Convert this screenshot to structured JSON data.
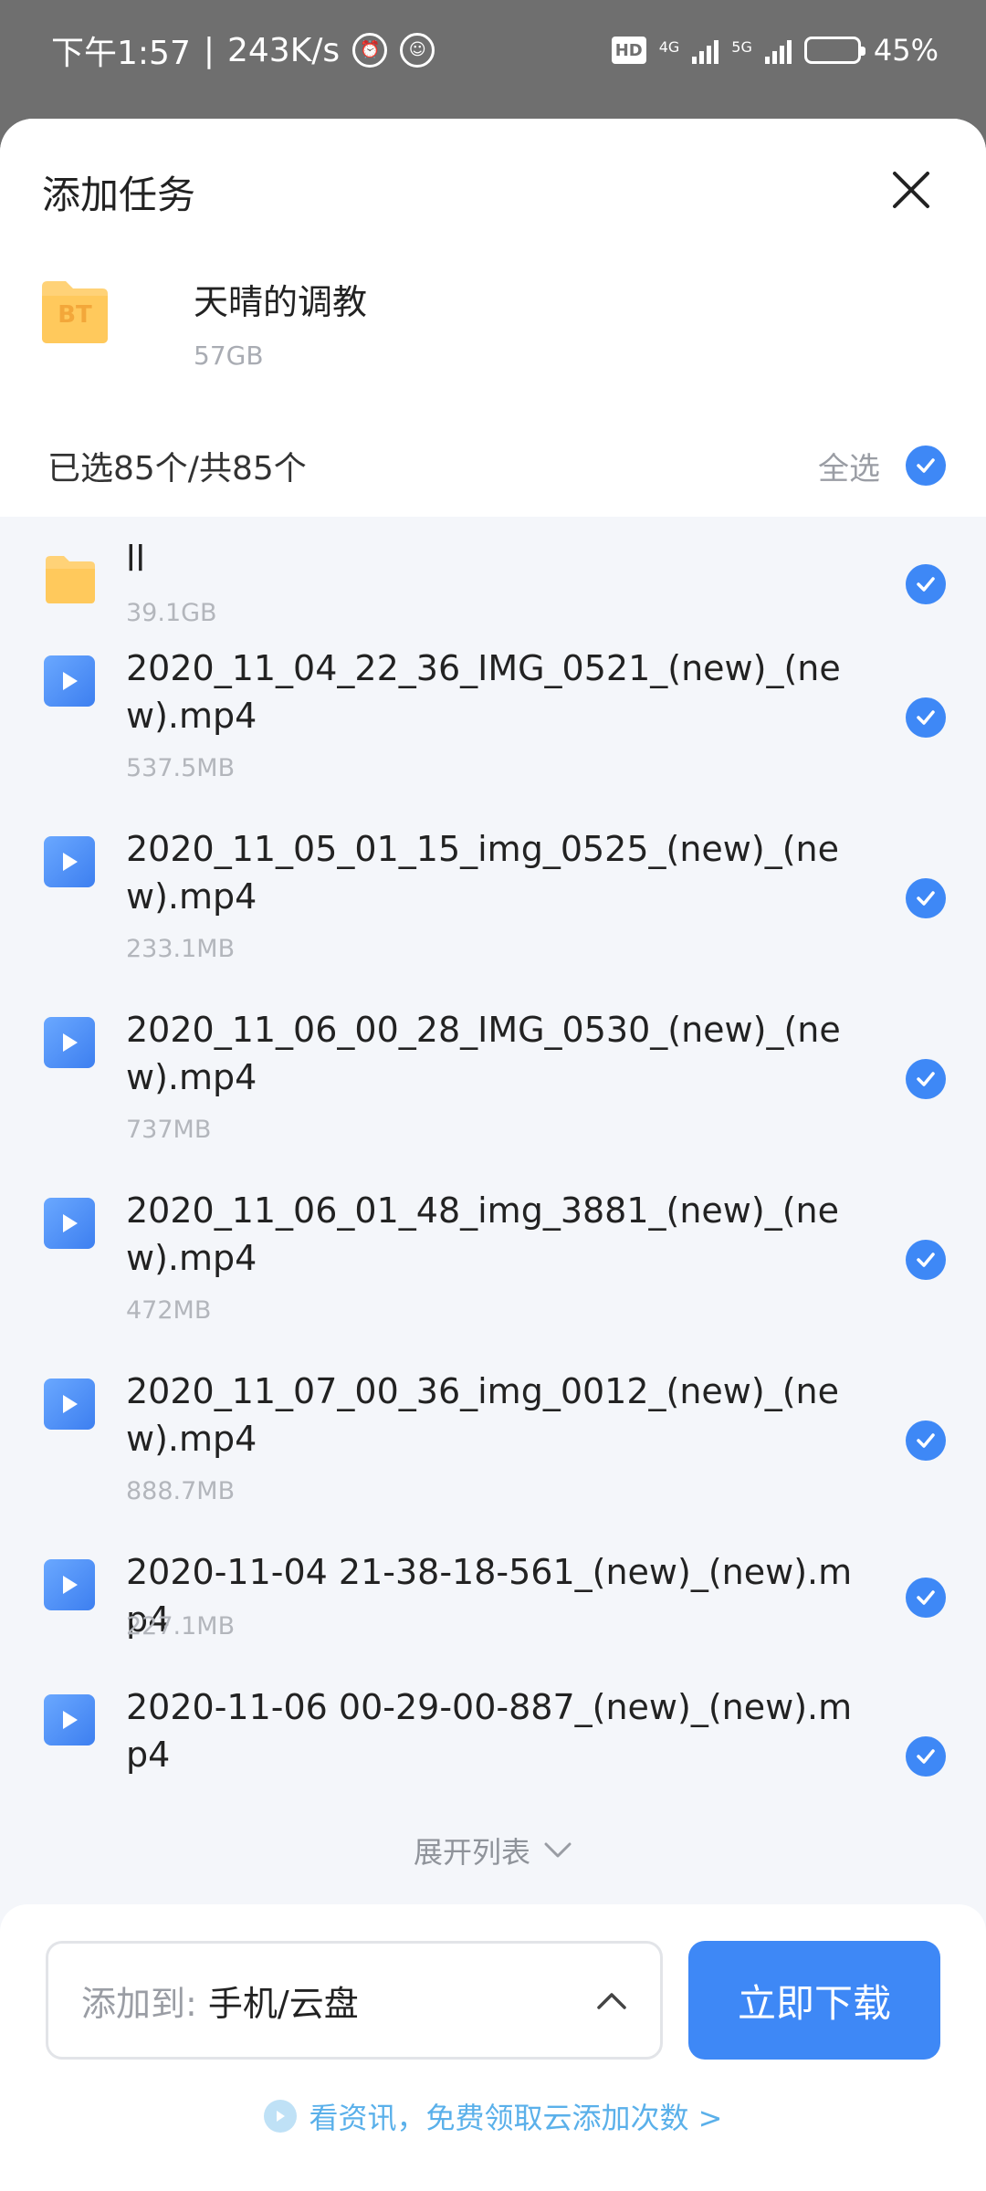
{
  "status_bar": {
    "time": "下午1:57",
    "speed": "243K/s",
    "hd_label": "HD",
    "sim1_label": "4G",
    "sim2_label": "5G",
    "battery": "45%",
    "battery_level": 0.45
  },
  "sheet": {
    "title": "添加任务",
    "torrent": {
      "badge": "BT",
      "name": "天晴的调教",
      "size": "57GB"
    },
    "selection": {
      "count_text": "已选85个/共85个",
      "select_all_label": "全选"
    },
    "items": [
      {
        "type": "folder",
        "name": "ll",
        "size": "39.1GB"
      },
      {
        "type": "video",
        "name": "2020_11_04_22_36_IMG_0521_(new)_(new).mp4",
        "size": "537.5MB"
      },
      {
        "type": "video",
        "name": "2020_11_05_01_15_img_0525_(new)_(new).mp4",
        "size": "233.1MB"
      },
      {
        "type": "video",
        "name": "2020_11_06_00_28_IMG_0530_(new)_(new).mp4",
        "size": "737MB"
      },
      {
        "type": "video",
        "name": "2020_11_06_01_48_img_3881_(new)_(new).mp4",
        "size": "472MB"
      },
      {
        "type": "video",
        "name": "2020_11_07_00_36_img_0012_(new)_(new).mp4",
        "size": "888.7MB"
      },
      {
        "type": "video",
        "name": "2020-11-04 21-38-18-561_(new)_(new).mp4",
        "size": "227.1MB"
      },
      {
        "type": "video",
        "name": "2020-11-06 00-29-00-887_(new)_(new).mp4",
        "size": ""
      }
    ],
    "expand_label": "展开列表"
  },
  "footer": {
    "dest_prefix": "添加到: ",
    "dest_value": "手机/云盘",
    "download_label": "立即下载",
    "promo_text": "看资讯，免费领取云添加次数 >"
  },
  "colors": {
    "accent": "#3e88f6",
    "folder": "#ffc95c",
    "promo": "#5ab0ea"
  }
}
